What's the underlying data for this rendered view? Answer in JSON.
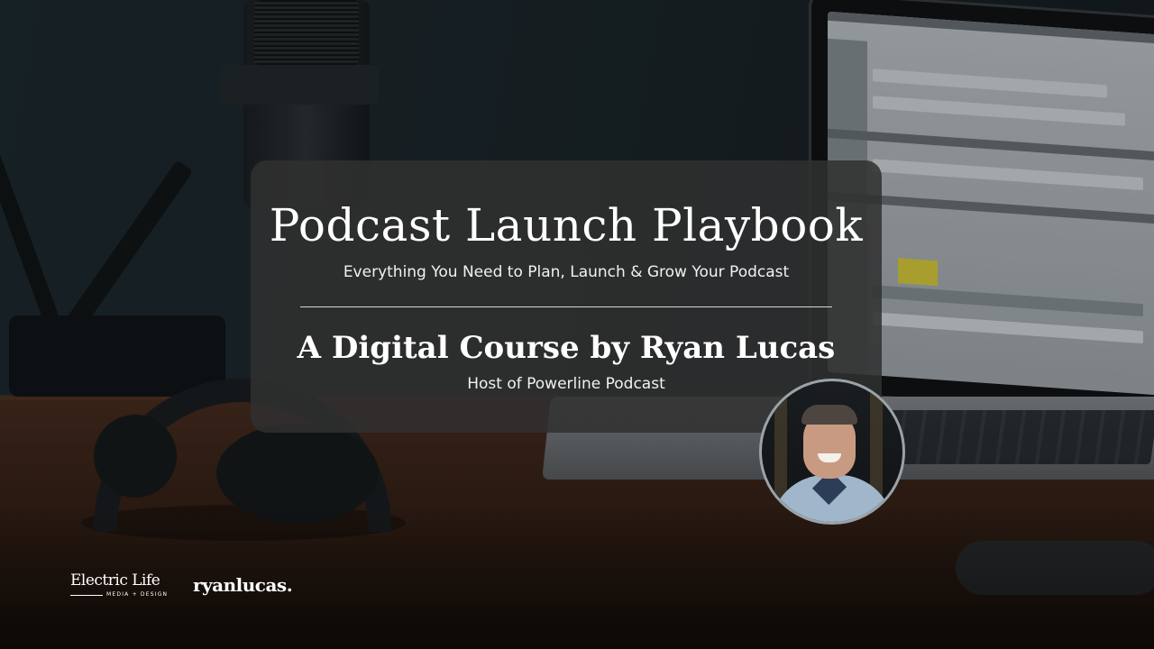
{
  "title": "Podcast Launch Playbook",
  "subtitle": "Everything You Need to Plan, Launch & Grow Your Podcast",
  "course_line": "A Digital Course by Ryan Lucas",
  "host_line": "Host of Powerline Podcast",
  "logos": {
    "electric_life": {
      "name": "Electric Life",
      "tagline": "MEDIA + DESIGN"
    },
    "ryan_lucas": "ryanlucas."
  },
  "colors": {
    "card_background": "#303030",
    "text": "#ffffff"
  }
}
